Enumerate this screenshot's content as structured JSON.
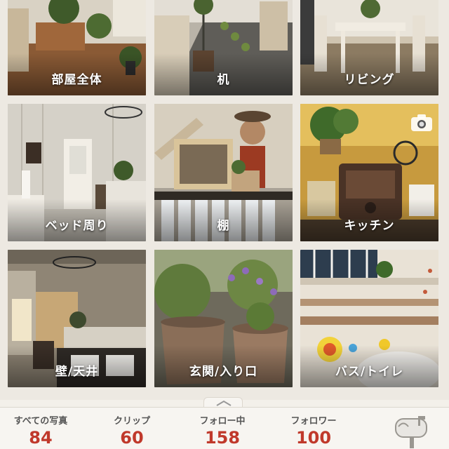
{
  "tiles": [
    {
      "label": "部屋全体"
    },
    {
      "label": "机"
    },
    {
      "label": "リビング"
    },
    {
      "label": "ベッド周り"
    },
    {
      "label": "棚"
    },
    {
      "label": "キッチン"
    },
    {
      "label": "壁/天井"
    },
    {
      "label": "玄関/入り口"
    },
    {
      "label": "バス/トイレ"
    }
  ],
  "footer": {
    "stats": [
      {
        "label": "すべての写真",
        "value": "84"
      },
      {
        "label": "クリップ",
        "value": "60"
      },
      {
        "label": "フォロー中",
        "value": "158"
      },
      {
        "label": "フォロワー",
        "value": "100"
      }
    ]
  },
  "colors": {
    "stat_value": "#c0392b",
    "background": "#f3f0ea"
  },
  "icons": {
    "camera": "camera-icon",
    "mailbox": "mailbox-icon",
    "expand": "chevron-up-icon"
  }
}
